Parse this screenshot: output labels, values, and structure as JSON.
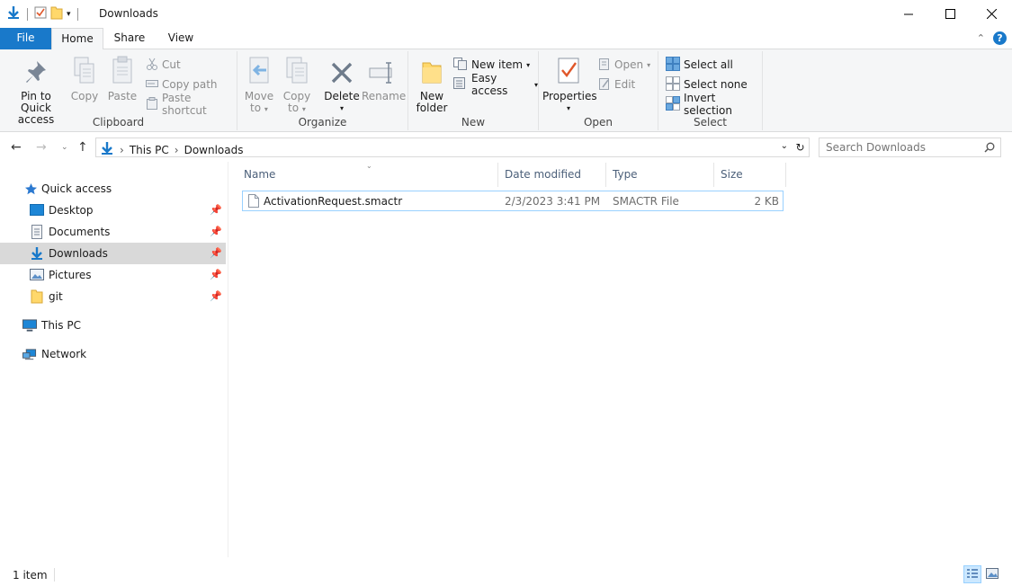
{
  "window": {
    "title": "Downloads"
  },
  "tabs": {
    "file": "File",
    "home": "Home",
    "share": "Share",
    "view": "View"
  },
  "ribbon": {
    "clipboard": {
      "label": "Clipboard",
      "pin_line1": "Pin to Quick",
      "pin_line2": "access",
      "copy": "Copy",
      "paste": "Paste",
      "cut": "Cut",
      "copy_path": "Copy path",
      "paste_shortcut": "Paste shortcut"
    },
    "organize": {
      "label": "Organize",
      "move_to_line1": "Move",
      "move_to_line2": "to",
      "copy_to_line1": "Copy",
      "copy_to_line2": "to",
      "delete": "Delete",
      "rename": "Rename"
    },
    "new": {
      "label": "New",
      "new_folder_line1": "New",
      "new_folder_line2": "folder",
      "new_item": "New item",
      "easy_access": "Easy access"
    },
    "open": {
      "label": "Open",
      "properties": "Properties",
      "open": "Open",
      "edit": "Edit"
    },
    "select": {
      "label": "Select",
      "select_all": "Select all",
      "select_none": "Select none",
      "invert_selection": "Invert selection"
    }
  },
  "address": {
    "crumbs": [
      "This PC",
      "Downloads"
    ],
    "search_placeholder": "Search Downloads"
  },
  "nav": {
    "quick_access": "Quick access",
    "items": [
      {
        "label": "Desktop",
        "icon": "desktop-icon"
      },
      {
        "label": "Documents",
        "icon": "documents-icon"
      },
      {
        "label": "Downloads",
        "icon": "downloads-icon"
      },
      {
        "label": "Pictures",
        "icon": "pictures-icon"
      },
      {
        "label": "git",
        "icon": "folder-icon"
      }
    ],
    "this_pc": "This PC",
    "network": "Network"
  },
  "files": {
    "columns": {
      "name": "Name",
      "date": "Date modified",
      "type": "Type",
      "size": "Size"
    },
    "rows": [
      {
        "name": "ActivationRequest.smactr",
        "date": "2/3/2023 3:41 PM",
        "type": "SMACTR File",
        "size": "2 KB"
      }
    ]
  },
  "status": {
    "count": "1 item"
  },
  "colors": {
    "accent": "#1979ca",
    "selection_border": "#99d1ff",
    "nav_selected": "#d9d9d9"
  }
}
